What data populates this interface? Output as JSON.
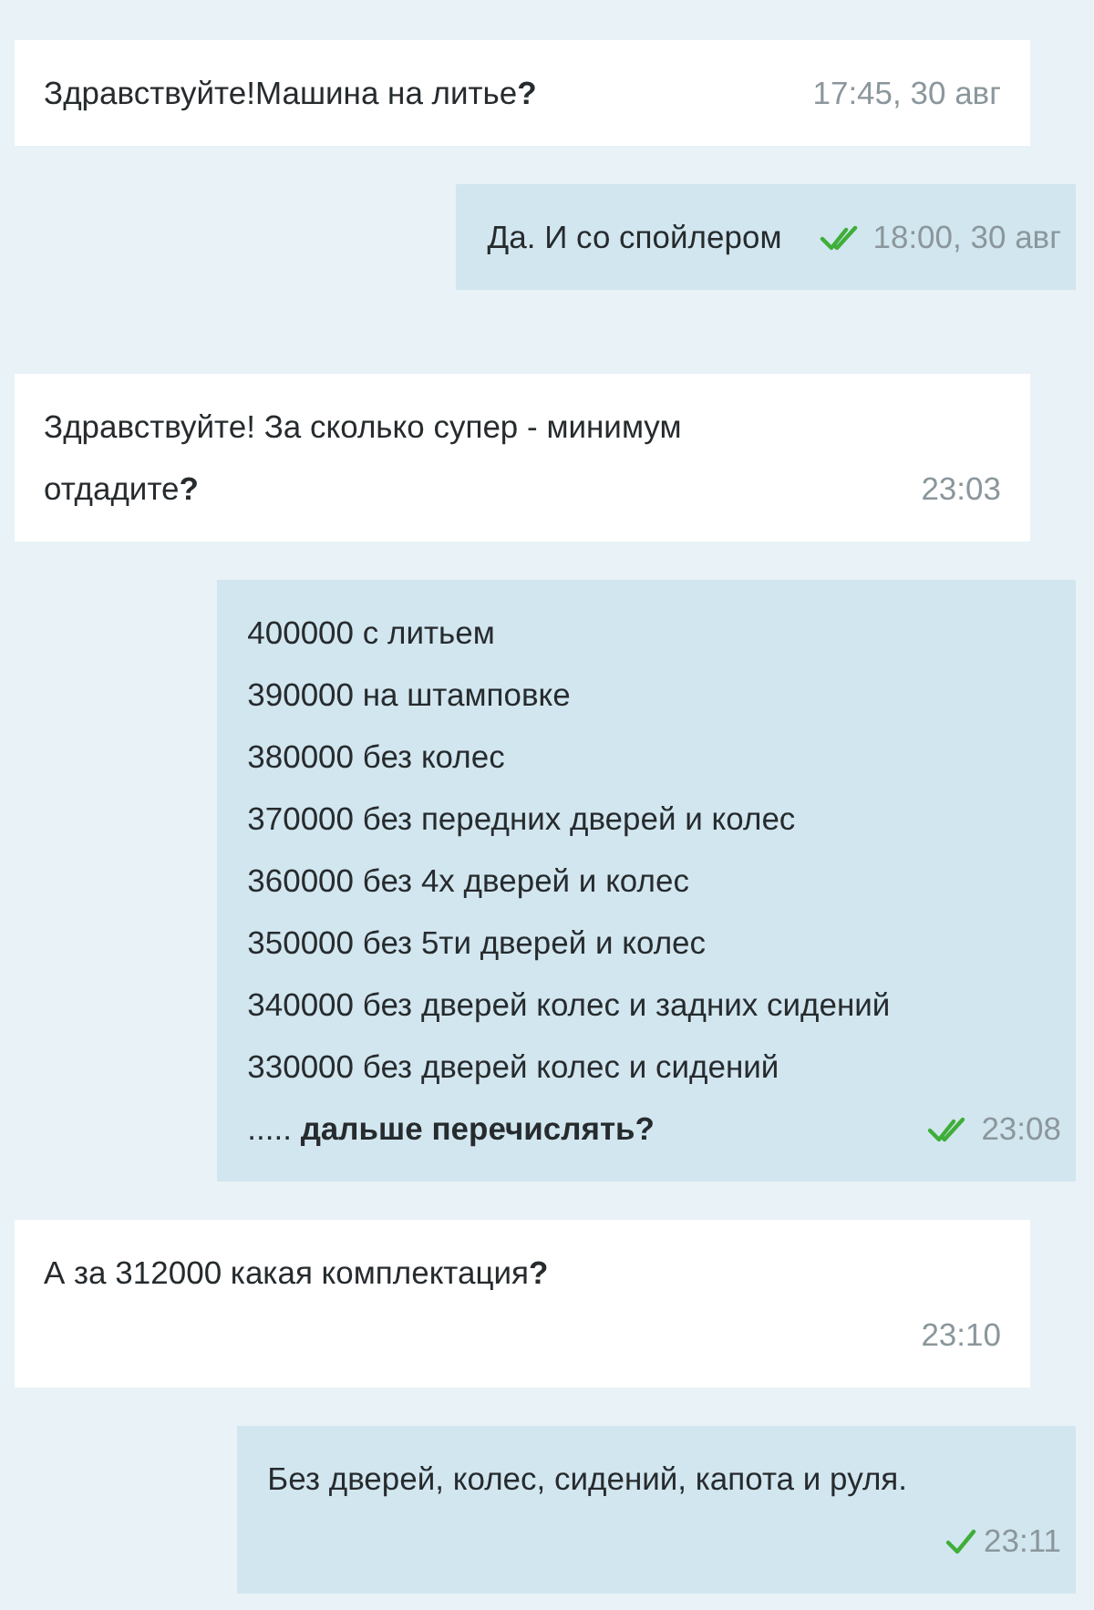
{
  "messages": [
    {
      "outgoing": false,
      "kind": "inline",
      "lines": [
        "Здравствуйте!Машина на литье**?**"
      ],
      "time": "17:45, 30 авг"
    },
    {
      "outgoing": true,
      "kind": "inline",
      "lines": [
        "Да. И со спойлером"
      ],
      "time": "18:00, 30 авг",
      "read": true
    },
    {
      "outgoing": false,
      "kind": "inline",
      "lines": [
        "Здравствуйте! За сколько супер - минимум",
        "отдадите**?**"
      ],
      "time": "23:03"
    },
    {
      "outgoing": true,
      "kind": "inline",
      "lines": [
        "400000 с литьем",
        "390000 на штамповке",
        "380000 без колес",
        "370000 без передних дверей и колес",
        "360000 без 4х дверей и колес",
        "350000 без 5ти дверей и колес",
        "340000 без дверей колес и задних сидений",
        "330000 без дверей колес и сидений",
        "..... **дальше перечислять?**"
      ],
      "time": "23:08",
      "read": true
    },
    {
      "outgoing": false,
      "kind": "stacked",
      "lines": [
        "А за 312000 какая комплектация**?**"
      ],
      "time": "23:10"
    },
    {
      "outgoing": true,
      "kind": "stacked",
      "lines": [
        "Без дверей, колес, сидений, капота и руля."
      ],
      "time": "23:11",
      "read": false
    }
  ]
}
